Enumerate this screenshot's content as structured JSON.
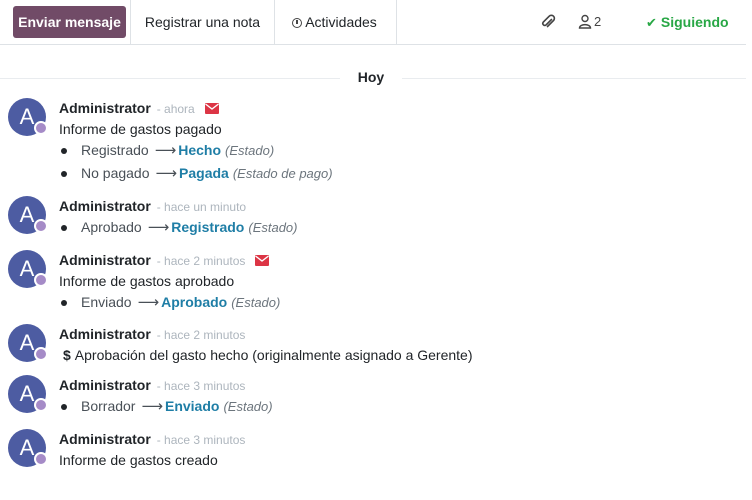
{
  "topbar": {
    "send_message": "Enviar mensaje",
    "log_note": "Registrar una nota",
    "activities": "Actividades",
    "follower_count": "2",
    "following": "Siguiendo"
  },
  "day_separator": "Hoy",
  "messages": [
    {
      "author": "Administrator",
      "date": "- ahora",
      "body": "Informe de gastos pagado",
      "tracking": [
        {
          "old": "Registrado",
          "new": "Hecho",
          "field": "(Estado)"
        },
        {
          "old": "No pagado",
          "new": "Pagada",
          "field": "(Estado de pago)"
        }
      ]
    },
    {
      "author": "Administrator",
      "date": "- hace un minuto",
      "tracking": [
        {
          "old": "Aprobado",
          "new": "Registrado",
          "field": "(Estado)"
        }
      ]
    },
    {
      "author": "Administrator",
      "date": "- hace 2 minutos",
      "body": "Informe de gastos aprobado",
      "tracking": [
        {
          "old": "Enviado",
          "new": "Aprobado",
          "field": "(Estado)"
        }
      ]
    },
    {
      "author": "Administrator",
      "date": "- hace 2 minutos",
      "body": "Aprobación del gasto hecho (originalmente asignado a Gerente)"
    },
    {
      "author": "Administrator",
      "date": "- hace 3 minutos",
      "tracking": [
        {
          "old": "Borrador",
          "new": "Enviado",
          "field": "(Estado)"
        }
      ]
    },
    {
      "author": "Administrator",
      "date": "- hace 3 minutos",
      "body": "Informe de gastos creado"
    }
  ],
  "avatar_initial": "A",
  "colors": {
    "brand": "#714b67",
    "avatar": "#4d5ca2",
    "link": "#1f7ea6",
    "following": "#28a745",
    "envelope": "#dc3545"
  }
}
